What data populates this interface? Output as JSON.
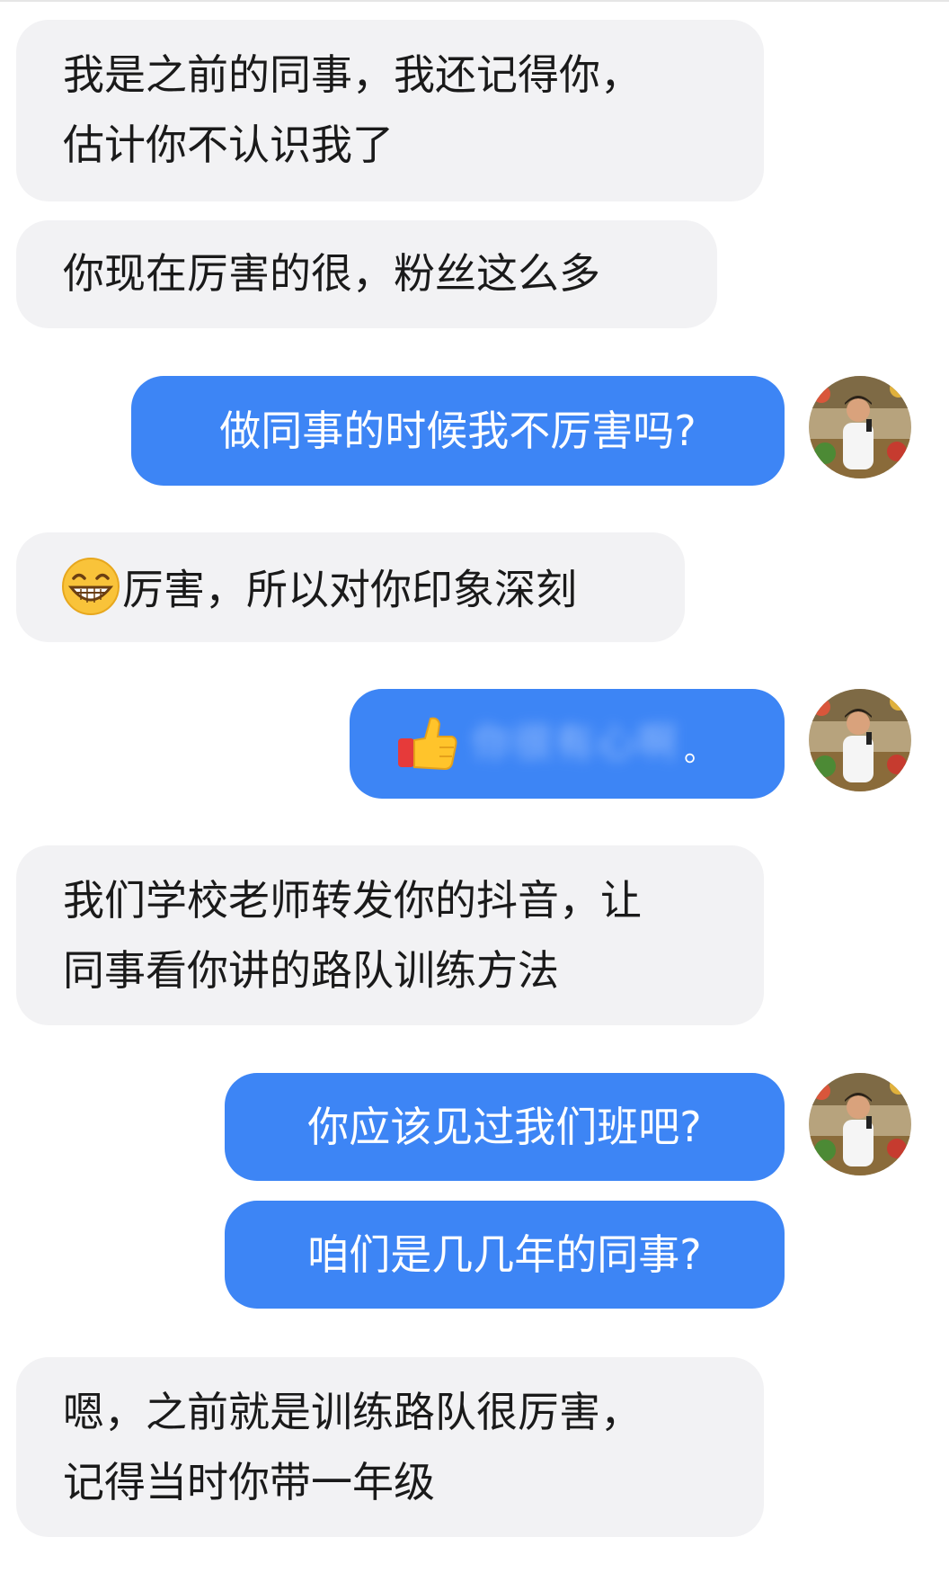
{
  "messages": [
    {
      "id": "m1",
      "side": "in",
      "lines": [
        "我是之前的同事，我还记得你，",
        "估计你不认识我了"
      ]
    },
    {
      "id": "m2",
      "side": "in",
      "lines": [
        "你现在厉害的很，粉丝这么多"
      ]
    },
    {
      "id": "m3",
      "side": "out",
      "text": "做同事的时候我不厉害吗?"
    },
    {
      "id": "m4",
      "side": "in",
      "emoji": "grinning-face",
      "text": "厉害，所以对你印象深刻"
    },
    {
      "id": "m5",
      "side": "out",
      "emoji": "thumbs-up",
      "blurred_text": "你很有心啊",
      "tail": "。"
    },
    {
      "id": "m6",
      "side": "in",
      "lines": [
        "我们学校老师转发你的抖音，让",
        "同事看你讲的路队训练方法"
      ]
    },
    {
      "id": "m7",
      "side": "out",
      "text": "你应该见过我们班吧?"
    },
    {
      "id": "m8",
      "side": "out",
      "text": "咱们是几几年的同事?"
    },
    {
      "id": "m9",
      "side": "in",
      "lines": [
        "嗯，之前就是训练路队很厉害，",
        "记得当时你带一年级"
      ]
    }
  ],
  "colors": {
    "incoming_bubble": "#f2f2f4",
    "outgoing_bubble": "#3d85f5",
    "incoming_text": "#1a1a1a",
    "outgoing_text": "#ffffff"
  },
  "icons": {
    "avatar": "user-avatar-photo",
    "grin": "grinning-face-emoji",
    "thumb": "thumbs-up-emoji"
  }
}
